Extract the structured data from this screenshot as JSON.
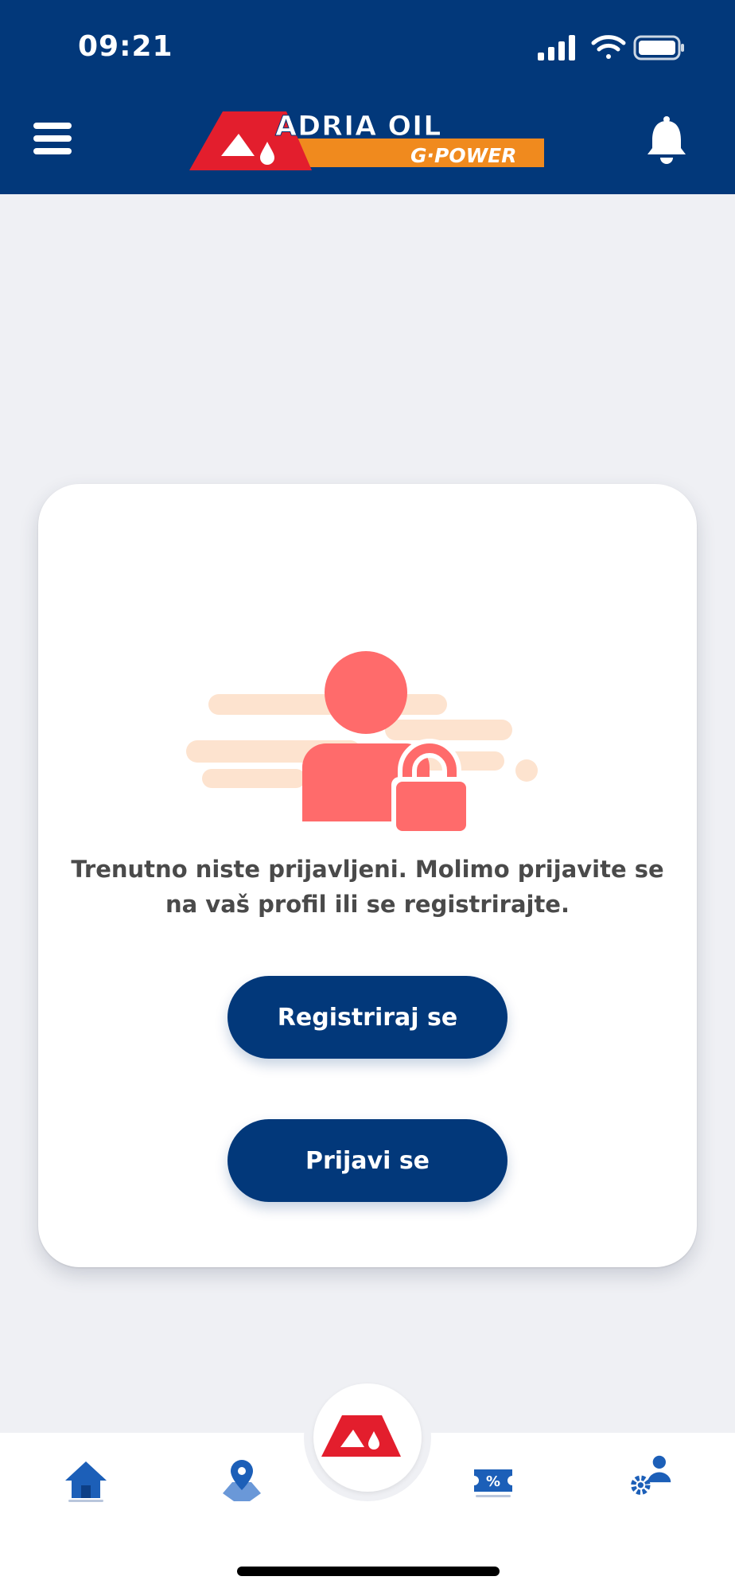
{
  "status_bar": {
    "time": "09:21",
    "icons": [
      "signal-icon",
      "wifi-icon",
      "battery-icon"
    ]
  },
  "header": {
    "logo": {
      "brand": "ADRIA OIL",
      "sub_brand": "G-POWER"
    },
    "left_icon": "menu-icon",
    "right_icon": "bell-icon"
  },
  "card": {
    "illustration_icon": "locked-user-icon",
    "message": "Trenutno niste prijavljeni. Molimo prijavite se na vaš profil ili se registrirajte.",
    "register_label": "Registriraj se",
    "login_label": "Prijavi se"
  },
  "bottom_nav": {
    "items": [
      {
        "icon": "home-icon"
      },
      {
        "icon": "map-pin-icon"
      },
      {
        "icon": "adria-logo-icon"
      },
      {
        "icon": "coupon-icon",
        "text": "%"
      },
      {
        "icon": "user-settings-icon"
      }
    ]
  },
  "colors": {
    "brand_blue": "#02387a",
    "brand_red": "#e31e2d",
    "brand_orange": "#f08a1e",
    "illustration_red": "#ff6b6b",
    "illustration_peach": "#fde3cf",
    "nav_icon_blue": "#1c5fb8",
    "background": "#eff0f4"
  }
}
